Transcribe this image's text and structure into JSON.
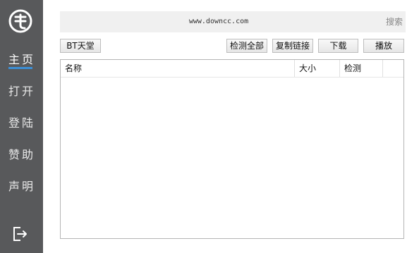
{
  "sidebar": {
    "logo_icon": "logo-icon",
    "items": [
      {
        "label": "主页",
        "active": true
      },
      {
        "label": "打开",
        "active": false
      },
      {
        "label": "登陆",
        "active": false
      },
      {
        "label": "赞助",
        "active": false
      },
      {
        "label": "声明",
        "active": false
      }
    ],
    "exit_icon": "exit-icon",
    "colors": {
      "background": "#58595b",
      "accent": "#3c8fd6"
    }
  },
  "search": {
    "url": "www.downcc.com",
    "button_label": "搜索"
  },
  "toolbar": {
    "bt_label": "BT天堂",
    "check_all_label": "检测全部",
    "copy_link_label": "复制链接",
    "download_label": "下载",
    "play_label": "播放"
  },
  "table": {
    "columns": [
      "名称",
      "大小",
      "检测",
      ""
    ],
    "rows": []
  }
}
